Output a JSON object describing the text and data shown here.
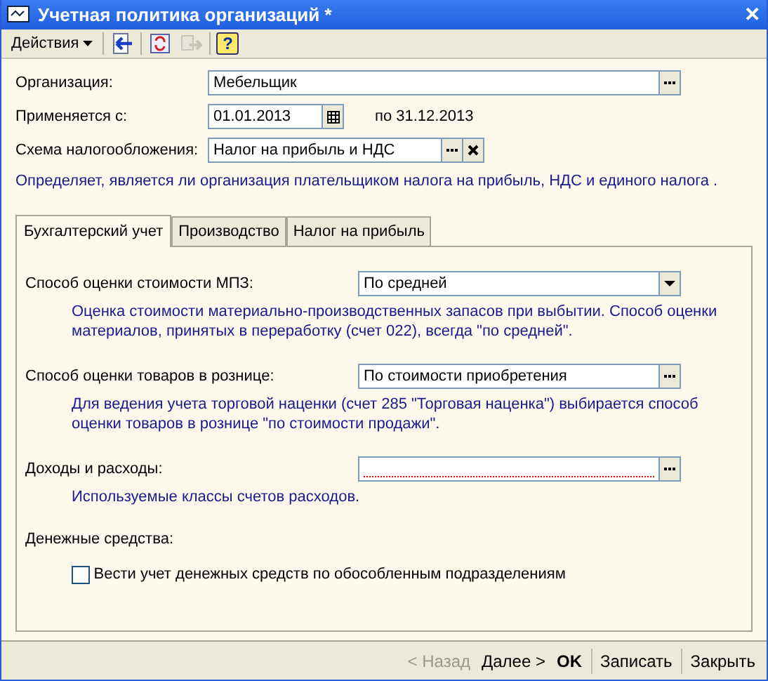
{
  "window": {
    "title": "Учетная политика организаций *",
    "close": "✕"
  },
  "toolbar": {
    "menu": "Действия",
    "buttons": [
      {
        "kind": "back",
        "disabled": false
      },
      {
        "kind": "refresh",
        "disabled": false
      },
      {
        "kind": "copy",
        "disabled": true
      },
      {
        "kind": "help",
        "disabled": false,
        "glyph": "?"
      }
    ]
  },
  "header": {
    "organization": {
      "label": "Организация:",
      "value": "Мебельщик"
    },
    "applies_from": {
      "label": "Применяется с:",
      "value": "01.01.2013",
      "until": "по 31.12.2013"
    },
    "tax_scheme": {
      "label": "Схема налогообложения:",
      "value": "Налог на прибыль и НДС",
      "hint": "Определяет, является ли организация плательщиком налога на прибыль, НДС и единого налога ."
    }
  },
  "tabs": [
    {
      "label": "Бухгалтерский учет",
      "selected": true
    },
    {
      "label": "Производство",
      "selected": false
    },
    {
      "label": "Налог на прибыль",
      "selected": false
    }
  ],
  "settings": [
    {
      "kind": "select",
      "label": "Способ оценки стоимости МПЗ:",
      "value": "По средней",
      "required": false,
      "hint": "Оценка стоимости материально-производственных запасов при выбытии. Способ оценки материалов, принятых в переработку (счет 022), всегда \"по средней\"."
    },
    {
      "kind": "choice",
      "label": "Способ оценки товаров в рознице:",
      "value": "По стоимости приобретения",
      "required": false,
      "hint": "Для ведения учета торговой наценки (счет 285 \"Торговая наценка\") выбирается способ оценки товаров в рознице \"по стоимости продажи\"."
    },
    {
      "kind": "choice",
      "label": "Доходы и расходы:",
      "required": true,
      "hint": "Используемые классы счетов расходов."
    }
  ],
  "cash": {
    "heading": "Денежные средства:",
    "checkbox": {
      "label": "Вести учет денежных средств по обособленным подразделениям",
      "checked": false
    }
  },
  "footer": [
    {
      "label": "< Назад",
      "disabled": true,
      "default": false,
      "separator": false
    },
    {
      "label": "Далее >",
      "disabled": false,
      "default": false,
      "separator": false
    },
    {
      "label": "OK",
      "disabled": false,
      "default": true,
      "separator": false
    },
    {
      "label": "Записать",
      "disabled": false,
      "default": false,
      "separator": true
    },
    {
      "label": "Закрыть",
      "disabled": false,
      "default": false,
      "separator": true
    }
  ]
}
